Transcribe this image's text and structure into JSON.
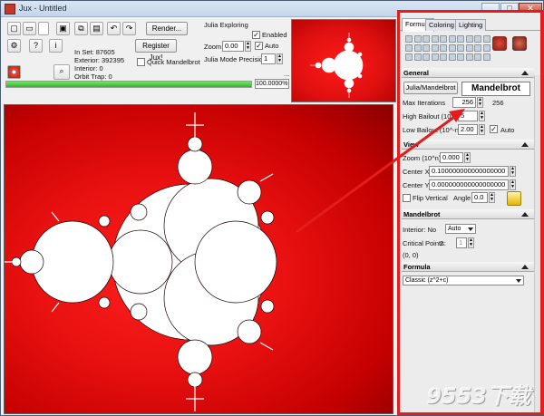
{
  "window": {
    "title": "Jux - Untitled",
    "minimize": "_",
    "maximize": "□",
    "close": "✕"
  },
  "toolbar": {
    "render_label": "Render...",
    "register_label": "Register Jux!",
    "quick_mandelbrot_label": "Quick Mandelbrot",
    "stats": {
      "in_set": "In Set: 87605",
      "exterior": "Exterior: 392395",
      "interior": "Interior: 0",
      "orbit_trap": "Orbit Trap: 0"
    },
    "julia_exploring_label": "Julia Exploring",
    "enabled_label": "Enabled",
    "zoom_label": "Zoom",
    "zoom_value": "0.00",
    "auto_label": "Auto",
    "julia_mode_precision_label": "Julia Mode Precision",
    "julia_mode_precision_value": "1",
    "ellipsis": "...",
    "progress_percent": 100,
    "progress_text": "100.0000%"
  },
  "tabs": [
    {
      "label": "Formula"
    },
    {
      "label": "Coloring"
    },
    {
      "label": "Lighting"
    }
  ],
  "general": {
    "title": "General",
    "julia_mandelbrot_label": "Julia/Mandelbrot",
    "mode_value": "Mandelbrot",
    "max_iterations_label": "Max Iterations",
    "max_iterations_value": "256",
    "max_iterations_display": "256",
    "high_bailout_label": "High Bailout (10^n)",
    "high_bailout_value": "5",
    "low_bailout_label": "Low Bailout (10^-n)",
    "low_bailout_value": "2.00",
    "auto_label": "Auto"
  },
  "view": {
    "title": "View",
    "zoom_label": "Zoom (10^n)",
    "zoom_value": "0.000",
    "center_x_label": "Center X",
    "center_x_value": "0.100000000000000000",
    "center_y_label": "Center Y",
    "center_y_value": "0.000000000000000000",
    "flip_vertical_label": "Flip Vertical",
    "angle_label": "Angle",
    "angle_value": "0.0"
  },
  "mandelbrot": {
    "title": "Mandelbrot",
    "interior_label": "Interior: No",
    "interior_value": "Auto",
    "critical_points_label": "Critical Points:",
    "critical_points_value": "2",
    "critical_points_spin": "1",
    "critical_point_coords": "(0, 0)"
  },
  "formula": {
    "title": "Formula",
    "value": "Classic (z^2+c)"
  },
  "watermark": "9553下载",
  "colors": {
    "fractal_red": "#e01010",
    "highlight_red": "#e31c1c",
    "accent_green": "#2eb72a"
  }
}
